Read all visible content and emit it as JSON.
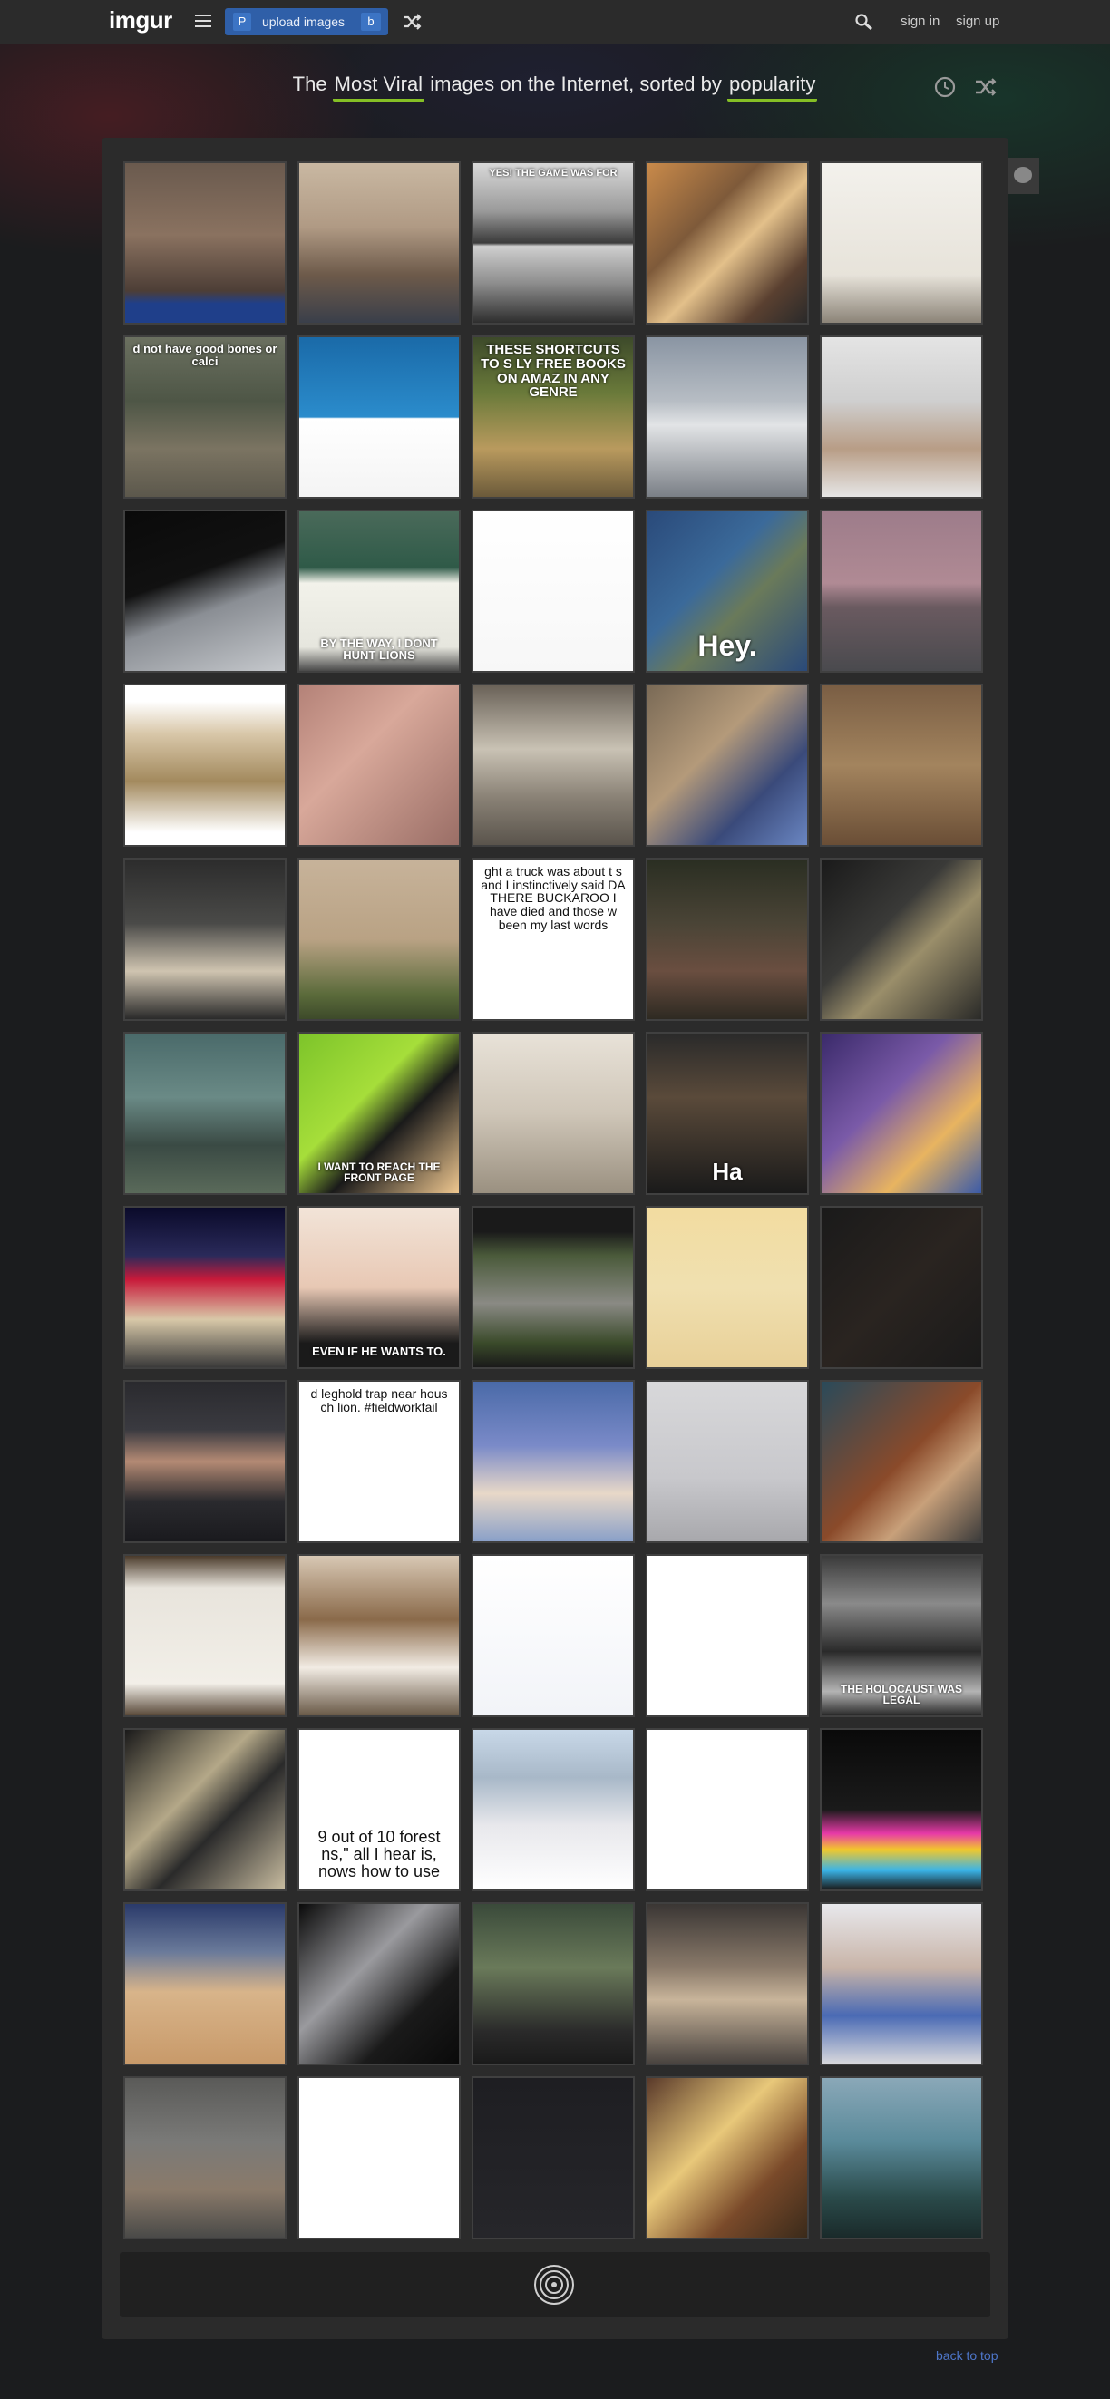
{
  "brand": {
    "logo": "imgur"
  },
  "topbar": {
    "upload_prefix": "P",
    "upload_label": "upload images",
    "upload_suffix": "b",
    "signin": "sign in",
    "signup": "sign up"
  },
  "heading": {
    "pre": "The ",
    "sort_section": "Most Viral",
    "mid": " images on the Internet, sorted by ",
    "sort_order": "popularity"
  },
  "footer": {
    "back_to_top": "back to top"
  },
  "colors": {
    "accent_green": "#85bf25",
    "upload_blue": "#2f5fa8",
    "link_blue": "#4e76c9"
  },
  "gallery": [
    [
      {
        "name": "crowd-stadium",
        "bg": "linear-gradient(180deg,#6a5a4e 0%,#8a7260 45%,#4d3e36 80%,#1f3f8a 88%,#1f3f8a 100%)",
        "caption": "",
        "size": 0,
        "pos": "bottom"
      },
      {
        "name": "two-men-handshake",
        "bg": "linear-gradient(180deg,#c9b8a2 0%,#b09a84 40%,#6d5a4a 70%,#3a3f4a 100%)",
        "caption": "",
        "size": 0,
        "pos": "bottom"
      },
      {
        "name": "monks-meme",
        "bg": "linear-gradient(180deg,#d9d9d9 0%,#9a9a9a 30%,#3a3a3a 50%,#cfcfcf 52%,#8e8e8e 75%,#2e2e2e 100%)",
        "caption": "YES! THE GAME WAS FOR",
        "size": 11,
        "pos": "top"
      },
      {
        "name": "cigarette-butts",
        "bg": "linear-gradient(135deg,#c98a4a 0%,#7e5a3a 35%,#e3c08a 55%,#5a4030 80%,#2a2a2a 100%)",
        "caption": "",
        "size": 0,
        "pos": "bottom"
      },
      {
        "name": "handwritten-note",
        "bg": "linear-gradient(180deg,#f3f1ec 0%,#e7e3da 70%,#8c8478 100%)",
        "caption": "",
        "size": 0,
        "pos": "bottom"
      }
    ],
    [
      {
        "name": "skyrim-scene",
        "bg": "linear-gradient(180deg,#6b7060 0%,#4e5646 40%,#7b7462 70%,#5c584c 100%)",
        "caption": "d not have good bones or calci",
        "size": 13,
        "pos": "top"
      },
      {
        "name": "manta-ray-tweet",
        "bg": "linear-gradient(180deg,#1a6aa8 0%,#2b8ccc 50%,#ffffff 51%,#f4f4f4 100%)",
        "caption": "",
        "size": 0,
        "pos": "bottom"
      },
      {
        "name": "duck-meme",
        "bg": "linear-gradient(180deg,#3d4a2a 0%,#6a7a3a 35%,#b99a5e 70%,#6b5a3a 100%)",
        "caption": "THESE SHORTCUTS TO S LY FREE BOOKS ON AMAZ IN ANY GENRE",
        "size": 15,
        "pos": "top"
      },
      {
        "name": "white-airship",
        "bg": "linear-gradient(180deg,#8a95a3 0%,#b7bdc4 40%,#e2e4e6 55%,#7a7f86 100%)",
        "caption": "",
        "size": 0,
        "pos": "bottom"
      },
      {
        "name": "star-wars-model",
        "bg": "linear-gradient(180deg,#e4e4e4 0%,#cfcfcf 40%,#b89d86 70%,#e6e6e6 100%)",
        "caption": "",
        "size": 0,
        "pos": "bottom"
      }
    ],
    [
      {
        "name": "window-view",
        "bg": "linear-gradient(160deg,#0a0a0a 0%,#111 40%,#8a8e94 60%,#c5c8cc 100%)",
        "caption": "",
        "size": 0,
        "pos": "bottom"
      },
      {
        "name": "dental-sign",
        "bg": "linear-gradient(180deg,#4a6a5a 0%,#2f5a48 35%,#f2f2ea 45%,#e6e6de 85%,#4a4a4a 100%)",
        "caption": "BY THE WAY, I DONT HUNT LIONS",
        "size": 13,
        "pos": "bottom"
      },
      {
        "name": "tweet-jackal",
        "bg": "linear-gradient(180deg,#ffffff 0%,#f7f7f7 100%)",
        "caption": "",
        "size": 0,
        "pos": "bottom",
        "dark": true
      },
      {
        "name": "map-hey",
        "bg": "linear-gradient(135deg,#2a4a7a 0%,#3b6a9a 40%,#6a7a5a 60%,#2a4a7a 100%)",
        "caption": "Hey.",
        "size": 32,
        "pos": "bottom"
      },
      {
        "name": "runway-plane",
        "bg": "linear-gradient(180deg,#9d7c8a 0%,#b08a94 45%,#6a5a60 60%,#4a4a4e 100%)",
        "caption": "",
        "size": 0,
        "pos": "bottom"
      }
    ],
    [
      {
        "name": "kitchen-photo",
        "bg": "linear-gradient(180deg,#ffffff 0%,#ffffff 10%,#d9c8aa 30%,#a38a5e 60%,#ffffff 92%)",
        "caption": "",
        "size": 0,
        "pos": "bottom"
      },
      {
        "name": "hand-pacifier",
        "bg": "linear-gradient(135deg,#b48278 0%,#d8a89a 40%,#9a6e66 100%)",
        "caption": "",
        "size": 0,
        "pos": "bottom"
      },
      {
        "name": "mri-machine",
        "bg": "linear-gradient(180deg,#6a6258 0%,#c9c2b4 40%,#8a8276 70%,#5a544c 100%)",
        "caption": "",
        "size": 0,
        "pos": "bottom"
      },
      {
        "name": "dog-selfie",
        "bg": "linear-gradient(135deg,#7a6a56 0%,#b49a7a 40%,#3a4a7a 70%,#6a86c2 100%)",
        "caption": "",
        "size": 0,
        "pos": "bottom"
      },
      {
        "name": "spray-bottle",
        "bg": "linear-gradient(180deg,#7a5e44 0%,#a3845e 50%,#6a4e36 100%)",
        "caption": "",
        "size": 0,
        "pos": "bottom"
      }
    ],
    [
      {
        "name": "white-snake",
        "bg": "linear-gradient(180deg,#2c2c2c 0%,#4a4a48 40%,#cfc4b0 70%,#2a2a2a 100%)",
        "caption": "",
        "size": 0,
        "pos": "bottom"
      },
      {
        "name": "bear-wolf-field",
        "bg": "linear-gradient(180deg,#c7b39a 0%,#b9a284 50%,#5a6a3a 85%,#3d4a2a 100%)",
        "caption": "",
        "size": 0,
        "pos": "bottom"
      },
      {
        "name": "buckaroo-text",
        "bg": "linear-gradient(180deg,#ffffff 0%,#ffffff 100%)",
        "caption": "ght a truck was about t s and I instinctively said DA THERE BUCKAROO I have died and those w been my last words",
        "size": 14,
        "pos": "top",
        "dark": true
      },
      {
        "name": "crowd-horses",
        "bg": "linear-gradient(180deg,#2a2e22 0%,#4a4436 40%,#6a4e40 70%,#2e2a22 100%)",
        "caption": "",
        "size": 0,
        "pos": "bottom"
      },
      {
        "name": "car-dashboard",
        "bg": "linear-gradient(135deg,#1a1a1a 0%,#3a3a38 40%,#9a8e6a 60%,#2a2a28 100%)",
        "caption": "",
        "size": 0,
        "pos": "bottom"
      }
    ],
    [
      {
        "name": "jet-crash",
        "bg": "linear-gradient(180deg,#4a6a6a 0%,#6a8a86 40%,#3a4a44 70%,#5a6a5a 100%)",
        "caption": "",
        "size": 0,
        "pos": "bottom"
      },
      {
        "name": "cartoon-front-page",
        "bg": "linear-gradient(135deg,#7dc42a 0%,#a6de3a 40%,#1a1a1a 60%,#f0c890 100%)",
        "caption": "I WANT TO REACH THE FRONT PAGE",
        "size": 12,
        "pos": "bottom"
      },
      {
        "name": "sheep-closeup",
        "bg": "linear-gradient(180deg,#e8e2d8 0%,#cfc6b8 50%,#9a9080 100%)",
        "caption": "",
        "size": 0,
        "pos": "bottom"
      },
      {
        "name": "laughing-man",
        "bg": "linear-gradient(180deg,#2a2a2a 0%,#5a4a3a 40%,#1a1a1a 100%)",
        "caption": "Ha",
        "size": 26,
        "pos": "bottom"
      },
      {
        "name": "cartoon-shopping",
        "bg": "linear-gradient(135deg,#3a2a6a 0%,#7a5aa8 40%,#e8b460 70%,#3a5aa8 100%)",
        "caption": "",
        "size": 0,
        "pos": "bottom"
      }
    ],
    [
      {
        "name": "basketball-court",
        "bg": "linear-gradient(180deg,#0a0a2a 0%,#2a2a5a 30%,#c81a3a 45%,#d8c8a8 70%,#3a3a3a 100%)",
        "caption": "",
        "size": 0,
        "pos": "bottom"
      },
      {
        "name": "baby-meme",
        "bg": "linear-gradient(180deg,#f2e4d8 0%,#e8c8b4 50%,#1a1a1a 85%,#1a1a1a 100%)",
        "caption": "EVEN IF HE WANTS TO.",
        "size": 13,
        "pos": "bottom"
      },
      {
        "name": "road-chicken",
        "bg": "linear-gradient(180deg,#1a1a1a 0%,#1a1a1a 15%,#4a5a3a 30%,#8a8a84 60%,#3a4a2a 85%,#1a1a1a 100%)",
        "caption": "",
        "size": 0,
        "pos": "bottom"
      },
      {
        "name": "comic-strip",
        "bg": "linear-gradient(180deg,#f2dca0 0%,#f0e0b0 50%,#e8d098 100%)",
        "caption": "",
        "size": 0,
        "pos": "bottom"
      },
      {
        "name": "dark-man",
        "bg": "linear-gradient(135deg,#1a1a1a 0%,#2a2420 50%,#1a1a1a 100%)",
        "caption": "",
        "size": 0,
        "pos": "bottom"
      }
    ],
    [
      {
        "name": "video-editor",
        "bg": "linear-gradient(180deg,#2a2a2e 0%,#3a3a40 30%,#b48a74 50%,#2a2a2e 75%,#1a1a1e 100%)",
        "caption": "",
        "size": 0,
        "pos": "bottom"
      },
      {
        "name": "tweet-fieldworkfail",
        "bg": "linear-gradient(180deg,#ffffff 0%,#ffffff 100%)",
        "caption": "d leghold trap near hous ch lion. #fieldworkfail",
        "size": 14,
        "pos": "top",
        "dark": true
      },
      {
        "name": "two-women",
        "bg": "linear-gradient(180deg,#4a6aa8 0%,#7a8ac8 40%,#e8d8c8 70%,#8aa0c8 100%)",
        "caption": "",
        "size": 0,
        "pos": "bottom"
      },
      {
        "name": "laptop-desk",
        "bg": "linear-gradient(180deg,#d8d8da 0%,#c8c8cc 60%,#a8a8ac 100%)",
        "caption": "",
        "size": 0,
        "pos": "bottom"
      },
      {
        "name": "painting-bed",
        "bg": "linear-gradient(135deg,#2a4a5a 0%,#8a4a2a 50%,#c8a07a 70%,#3a3a3a 100%)",
        "caption": "",
        "size": 0,
        "pos": "bottom"
      }
    ],
    [
      {
        "name": "handwritten-list",
        "bg": "linear-gradient(180deg,#4a3a2a 0%,#e8e4dc 20%,#f2efe8 80%,#5a4a3a 100%)",
        "caption": "",
        "size": 0,
        "pos": "bottom"
      },
      {
        "name": "collie-dog",
        "bg": "linear-gradient(180deg,#d8c8b4 0%,#8a6a4a 40%,#f2ece4 70%,#6a5a48 100%)",
        "caption": "",
        "size": 0,
        "pos": "bottom"
      },
      {
        "name": "facebook-comments",
        "bg": "linear-gradient(180deg,#ffffff 0%,#f2f4f8 100%)",
        "caption": "",
        "size": 0,
        "pos": "bottom"
      },
      {
        "name": "depression-pie",
        "bg": "linear-gradient(180deg,#ffffff 0%,#ffffff 100%)",
        "caption": "",
        "size": 0,
        "pos": "bottom"
      },
      {
        "name": "history-meme",
        "bg": "linear-gradient(180deg,#3a3a3a 0%,#8a8a8a 30%,#2a2a2a 60%,#b4b4b4 85%,#2a2a2a 100%)",
        "caption": "THE HOLOCAUST WAS LEGAL",
        "size": 12,
        "pos": "bottom"
      }
    ],
    [
      {
        "name": "tile-floor",
        "bg": "linear-gradient(135deg,#1a1a1a 0%,#b4a888 40%,#2a2a2a 60%,#c8bca0 100%)",
        "caption": "",
        "size": 0,
        "pos": "bottom"
      },
      {
        "name": "forest-quote",
        "bg": "linear-gradient(180deg,#ffffff 0%,#ffffff 100%)",
        "caption": "9 out of 10 forest ns,\" all I hear is, nows how to use",
        "size": 18,
        "pos": "bottom",
        "dark": true
      },
      {
        "name": "couple-photo",
        "bg": "linear-gradient(180deg,#c8d8e8 0%,#a8b8c8 30%,#e8e8ec 60%,#ffffff 100%)",
        "caption": "",
        "size": 0,
        "pos": "bottom"
      },
      {
        "name": "lesson-text",
        "bg": "linear-gradient(180deg,#ffffff 0%,#ffffff 100%)",
        "caption": "",
        "size": 0,
        "pos": "bottom"
      },
      {
        "name": "rainbow-road",
        "bg": "linear-gradient(180deg,#0a0a0a 0%,#1a1a1a 50%,#e83aa8 65%,#f2c82a 75%,#3ab4e8 88%,#1a1a1a 100%)",
        "caption": "",
        "size": 0,
        "pos": "bottom"
      }
    ],
    [
      {
        "name": "kids-gym",
        "bg": "linear-gradient(180deg,#2a3a6a 0%,#6a7a9a 30%,#d8b48a 55%,#c89a6a 100%)",
        "caption": "",
        "size": 0,
        "pos": "bottom"
      },
      {
        "name": "star-destroyer",
        "bg": "linear-gradient(135deg,#0a0a0a 0%,#9a9a9e 40%,#1a1a1a 70%,#0a0a0a 100%)",
        "caption": "",
        "size": 0,
        "pos": "bottom"
      },
      {
        "name": "two-men-scene",
        "bg": "linear-gradient(180deg,#3a4a3a 0%,#6a7a5a 40%,#2a2a2a 80%,#1a1a1a 100%)",
        "caption": "",
        "size": 0,
        "pos": "bottom"
      },
      {
        "name": "egyptian-statue",
        "bg": "linear-gradient(180deg,#3a3634 0%,#8a7a6a 40%,#c8b49a 60%,#4a4440 100%)",
        "caption": "",
        "size": 0,
        "pos": "bottom"
      },
      {
        "name": "store-shoppers",
        "bg": "linear-gradient(180deg,#e8e8ec 0%,#c8b4a8 40%,#4a6ab4 70%,#d8d8dc 100%)",
        "caption": "",
        "size": 0,
        "pos": "bottom"
      }
    ],
    [
      {
        "name": "hand-cat",
        "bg": "linear-gradient(180deg,#5a5a58 0%,#7a7a78 40%,#8a7a6a 70%,#4a4a48 100%)",
        "caption": "",
        "size": 0,
        "pos": "bottom"
      },
      {
        "name": "obama-tweet",
        "bg": "linear-gradient(180deg,#ffffff 0%,#ffffff 100%)",
        "caption": "",
        "size": 0,
        "pos": "bottom"
      },
      {
        "name": "code-editor",
        "bg": "linear-gradient(180deg,#1e1e22 0%,#26262a 100%)",
        "caption": "",
        "size": 0,
        "pos": "bottom"
      },
      {
        "name": "sticky-notes",
        "bg": "linear-gradient(135deg,#5a3a2a 0%,#e8c87a 40%,#7a4a2a 70%,#3a2a1a 100%)",
        "caption": "",
        "size": 0,
        "pos": "bottom"
      },
      {
        "name": "fantasy-tower",
        "bg": "linear-gradient(180deg,#8aa8b8 0%,#5a8a9a 40%,#2a4a4a 75%,#1a2a2a 100%)",
        "caption": "",
        "size": 0,
        "pos": "bottom"
      }
    ]
  ]
}
